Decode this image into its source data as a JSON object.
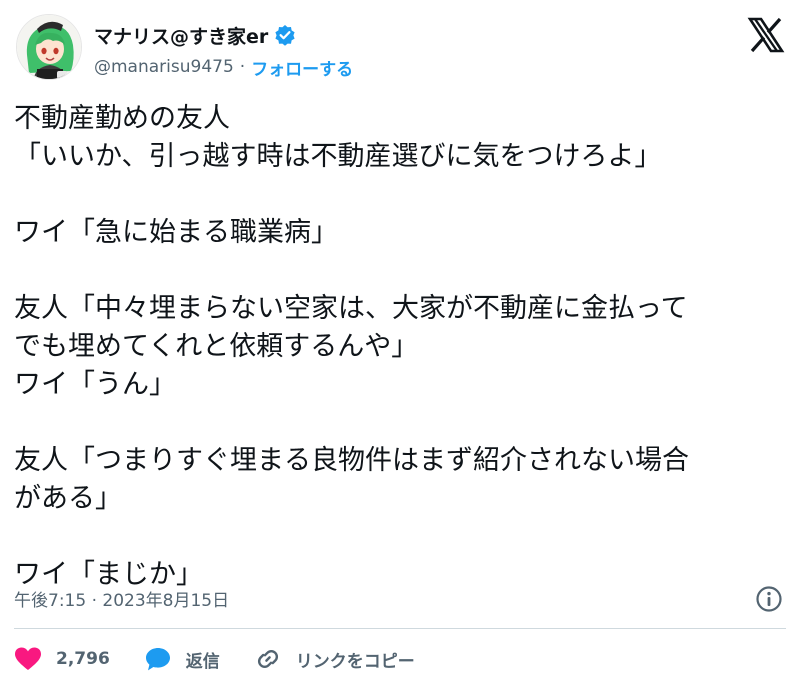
{
  "user": {
    "display_name": "マナリス@すき家er",
    "handle": "@manarisu9475",
    "separator": "·",
    "follow_label": "フォローする",
    "verified": true,
    "avatar": "green-haired-anime-character-avatar"
  },
  "tweet": {
    "lines": [
      "不動産勤めの友人",
      "「いいか、引っ越す時は不動産選びに気をつけろよ」",
      "",
      "ワイ「急に始まる職業病」",
      "",
      "友人「中々埋まらない空家は、大家が不動産に金払って",
      "でも埋めてくれと依頼するんや」",
      "ワイ「うん」",
      "",
      "友人「つまりすぐ埋まる良物件はまず紹介されない場合",
      "がある」",
      "",
      "ワイ「まじか」"
    ],
    "timestamp": "午後7:15 · 2023年8月15日"
  },
  "actions": {
    "like_count": "2,796",
    "reply_label": "返信",
    "copy_link_label": "リンクをコピー"
  },
  "icons": {
    "brand": "x-logo",
    "info": "info-icon",
    "like": "heart-icon",
    "reply": "speech-bubble-icon",
    "link": "link-icon"
  },
  "colors": {
    "text": "#0f1419",
    "muted": "#536471",
    "accent": "#1d9bf0",
    "like": "#f91880",
    "divider": "#cfd9de"
  }
}
